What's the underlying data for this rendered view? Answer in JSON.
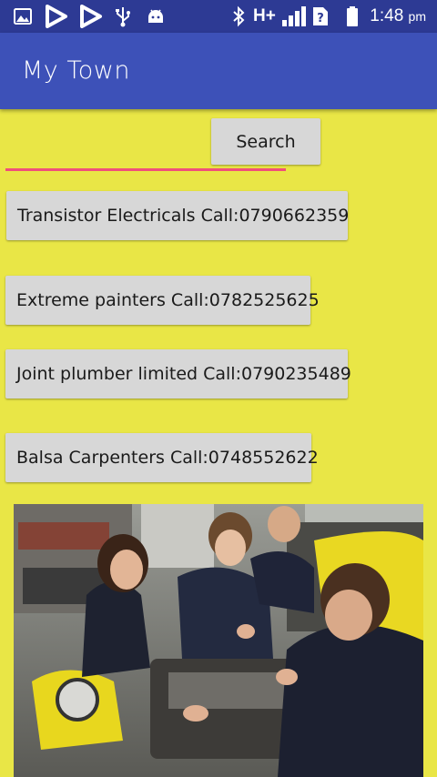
{
  "status_bar": {
    "time": "1:48",
    "ampm": "pm",
    "network": "H+"
  },
  "app": {
    "title": "My Town"
  },
  "search": {
    "value": "",
    "placeholder": "",
    "button_label": "Search"
  },
  "contacts": [
    {
      "label": "Transistor Electricals Call:0790662359"
    },
    {
      "label": "Extreme painters Call:0782525625"
    },
    {
      "label": "Joint plumber limited Call:0790235489"
    },
    {
      "label": "Balsa Carpenters Call:0748552622"
    }
  ],
  "colors": {
    "background": "#e9e646",
    "app_bar": "#3d51b8",
    "status_bar": "#2d3a94",
    "accent_underline": "#f0507a",
    "button": "#d7d7d7"
  },
  "icons": [
    "image-icon",
    "play-icon",
    "play-icon",
    "usb-icon",
    "android-icon",
    "bluetooth-icon",
    "signal-icon",
    "sim-alert-icon",
    "battery-icon"
  ]
}
